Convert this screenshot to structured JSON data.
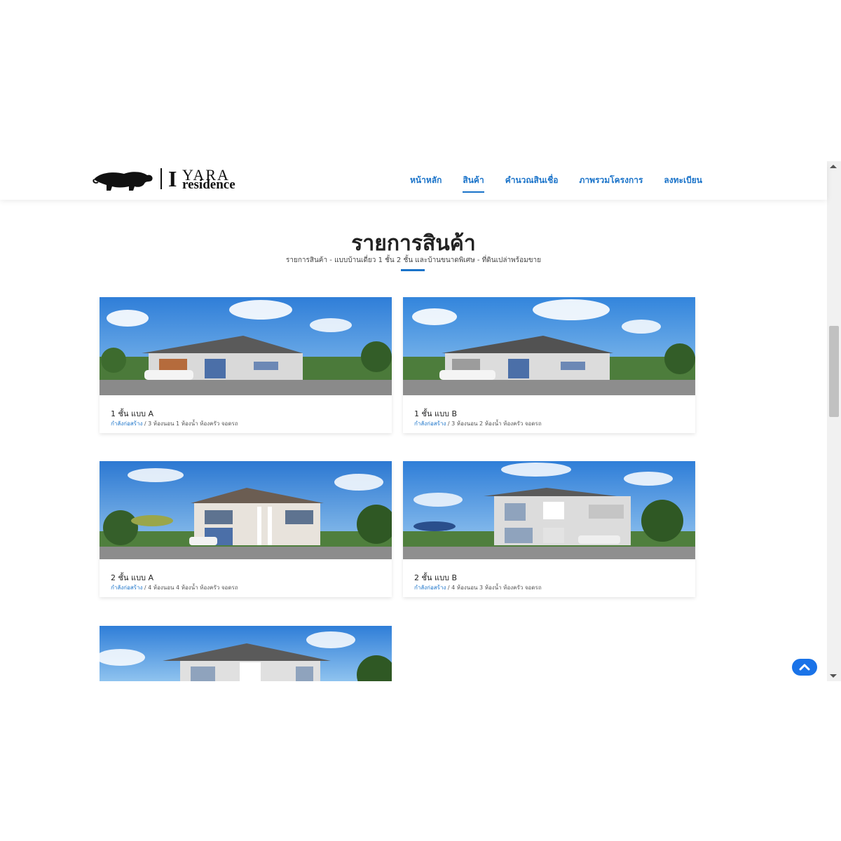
{
  "brand": {
    "logo_word": "YARA",
    "logo_sub": "residence",
    "logo_initial": "I"
  },
  "nav": {
    "items": [
      {
        "label": "หน้าหลัก",
        "active": false
      },
      {
        "label": "สินค้า",
        "active": true
      },
      {
        "label": "คำนวณสินเชื่อ",
        "active": false
      },
      {
        "label": "ภาพรวมโครงการ",
        "active": false
      },
      {
        "label": "ลงทะเบียน",
        "active": false
      }
    ]
  },
  "section": {
    "title": "รายการสินค้า",
    "subtitle": "รายการสินค้า - แบบบ้านเดี่ยว 1 ชั้น 2 ชั้น และบ้านขนาดพิเศษ - ที่ดินเปล่าพร้อมขาย"
  },
  "products": [
    {
      "title": "1 ชั้น แบบ A",
      "status": "กำลังก่อสร้าง",
      "details": " / 3 ห้องนอน 1 ห้องน้ำ ห้องครัว จอดรถ"
    },
    {
      "title": "1 ชั้น แบบ B",
      "status": "กำลังก่อสร้าง",
      "details": " / 3 ห้องนอน 2 ห้องน้ำ ห้องครัว จอดรถ"
    },
    {
      "title": "2 ชั้น แบบ A",
      "status": "กำลังก่อสร้าง",
      "details": " / 4 ห้องนอน 4 ห้องน้ำ ห้องครัว จอดรถ"
    },
    {
      "title": "2 ชั้น แบบ B",
      "status": "กำลังก่อสร้าง",
      "details": " / 4 ห้องนอน 3 ห้องน้ำ ห้องครัว จอดรถ"
    }
  ],
  "colors": {
    "accent": "#1a73c9",
    "back_to_top": "#1a73e8"
  },
  "icons": {
    "logo": "elephant-icon",
    "back_to_top": "chevron-up-icon"
  }
}
